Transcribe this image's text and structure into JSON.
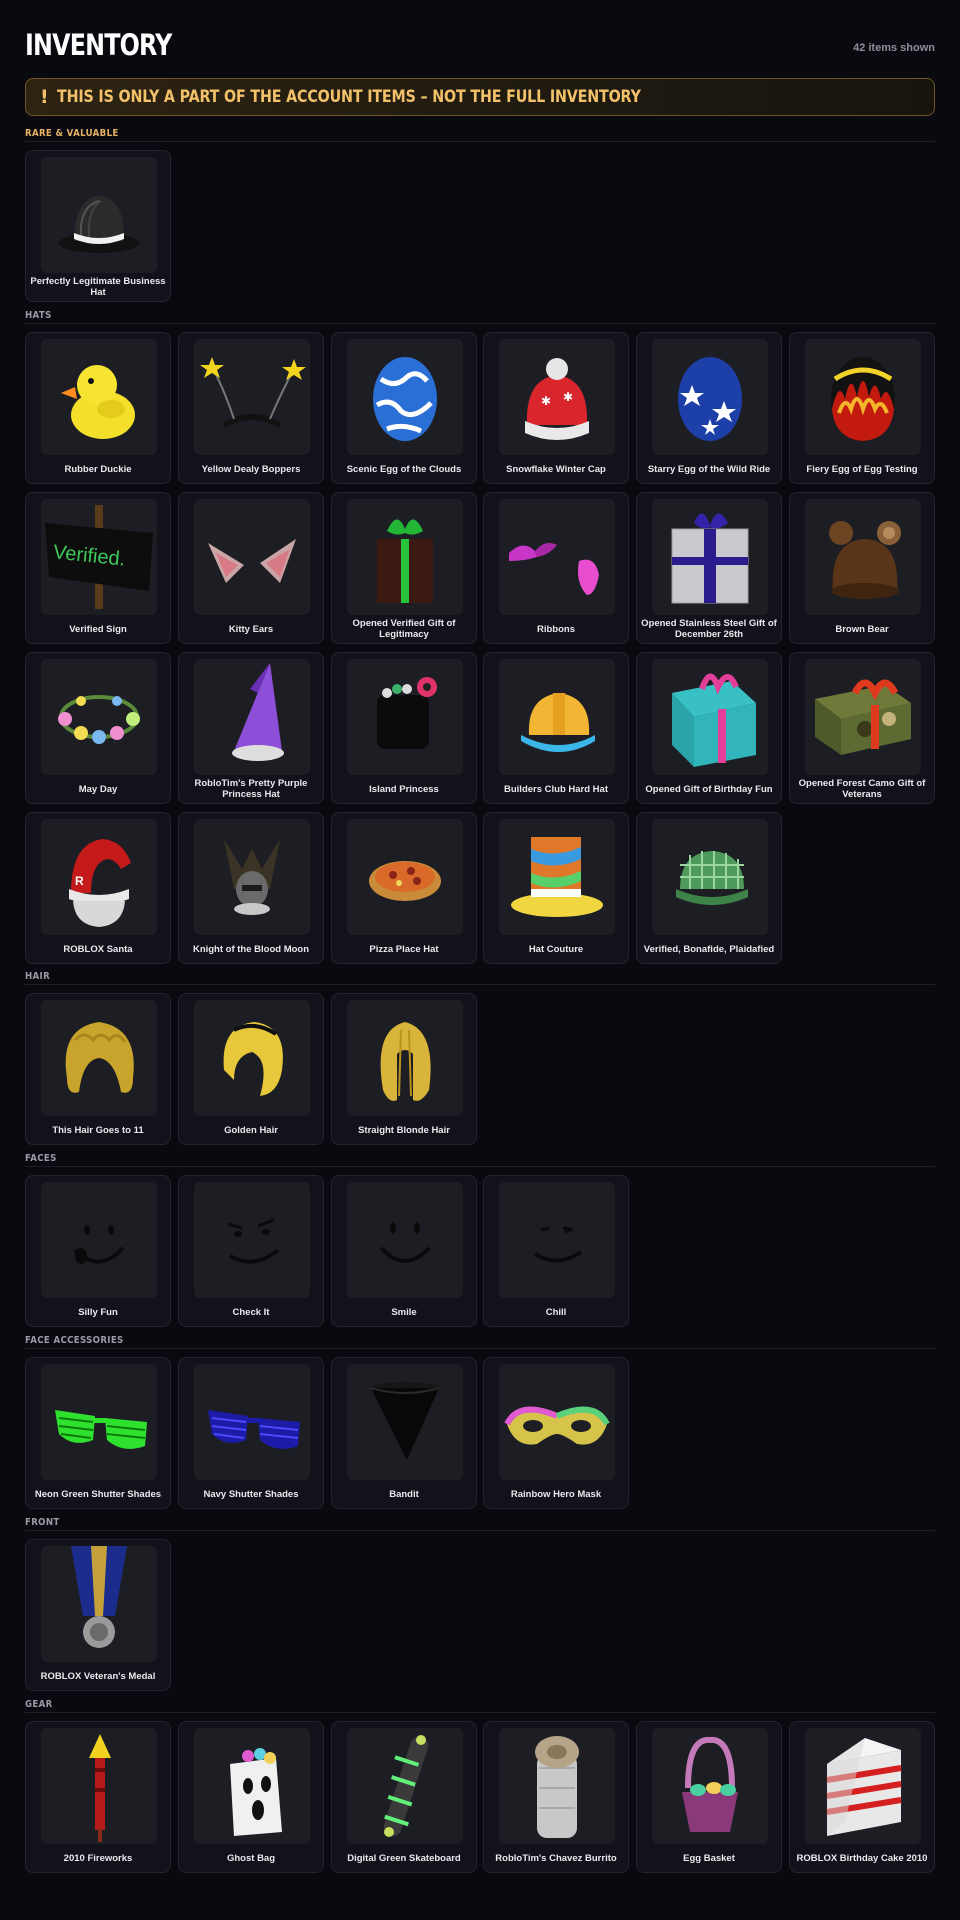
{
  "header": {
    "title": "INVENTORY",
    "count_label": "42 items shown"
  },
  "warning": {
    "text": "THIS IS ONLY A PART OF THE ACCOUNT ITEMS – NOT THE FULL INVENTORY",
    "icon": "exclamation-icon"
  },
  "colors": {
    "background": "#090a10",
    "card": "#12131a",
    "accent": "#e5b063"
  },
  "sections": [
    {
      "label": "RARE & VALUABLE",
      "items": [
        {
          "name": "Perfectly Legitimate Business Hat",
          "icon": "fedora"
        }
      ]
    },
    {
      "label": "HATS",
      "items": [
        {
          "name": "Rubber Duckie",
          "icon": "duck"
        },
        {
          "name": "Yellow Dealy Boppers",
          "icon": "boppers"
        },
        {
          "name": "Scenic Egg of the Clouds",
          "icon": "egg-clouds"
        },
        {
          "name": "Snowflake Winter Cap",
          "icon": "winter-cap"
        },
        {
          "name": "Starry Egg of the Wild Ride",
          "icon": "egg-stars"
        },
        {
          "name": "Fiery Egg of Egg Testing",
          "icon": "egg-fire"
        },
        {
          "name": "Verified Sign",
          "icon": "sign"
        },
        {
          "name": "Kitty Ears",
          "icon": "kitty-ears"
        },
        {
          "name": "Opened Verified Gift of Legitimacy",
          "icon": "gift-dark"
        },
        {
          "name": "Ribbons",
          "icon": "ribbons"
        },
        {
          "name": "Opened Stainless Steel Gift of December 26th",
          "icon": "gift-steel"
        },
        {
          "name": "Brown Bear",
          "icon": "bear-hat"
        },
        {
          "name": "May Day",
          "icon": "flower-crown"
        },
        {
          "name": "RobloTim's Pretty Purple Princess Hat",
          "icon": "princess-hat"
        },
        {
          "name": "Island Princess",
          "icon": "island-princess"
        },
        {
          "name": "Builders Club Hard Hat",
          "icon": "hard-hat"
        },
        {
          "name": "Opened Gift of Birthday Fun",
          "icon": "gift-teal"
        },
        {
          "name": "Opened Forest Camo Gift of Veterans",
          "icon": "gift-camo"
        },
        {
          "name": "ROBLOX Santa",
          "icon": "santa"
        },
        {
          "name": "Knight of the Blood Moon",
          "icon": "knight"
        },
        {
          "name": "Pizza Place Hat",
          "icon": "pizza"
        },
        {
          "name": "Hat Couture",
          "icon": "couture"
        },
        {
          "name": "Verified, Bonafide, Plaidafied",
          "icon": "plaid-cap"
        }
      ]
    },
    {
      "label": "HAIR",
      "items": [
        {
          "name": "This Hair Goes to 11",
          "icon": "hair-curly"
        },
        {
          "name": "Golden Hair",
          "icon": "hair-golden"
        },
        {
          "name": "Straight Blonde Hair",
          "icon": "hair-straight"
        }
      ]
    },
    {
      "label": "FACES",
      "items": [
        {
          "name": "Silly Fun",
          "icon": "face-silly"
        },
        {
          "name": "Check It",
          "icon": "face-check"
        },
        {
          "name": "Smile",
          "icon": "face-smile"
        },
        {
          "name": "Chill",
          "icon": "face-chill"
        }
      ]
    },
    {
      "label": "FACE ACCESSORIES",
      "items": [
        {
          "name": "Neon Green Shutter Shades",
          "icon": "shades-green"
        },
        {
          "name": "Navy Shutter Shades",
          "icon": "shades-navy"
        },
        {
          "name": "Bandit",
          "icon": "bandit"
        },
        {
          "name": "Rainbow Hero Mask",
          "icon": "hero-mask"
        }
      ]
    },
    {
      "label": "FRONT",
      "items": [
        {
          "name": "ROBLOX Veteran's Medal",
          "icon": "medal"
        }
      ]
    },
    {
      "label": "GEAR",
      "items": [
        {
          "name": "2010 Fireworks",
          "icon": "firework"
        },
        {
          "name": "Ghost Bag",
          "icon": "ghost-bag"
        },
        {
          "name": "Digital Green Skateboard",
          "icon": "skateboard"
        },
        {
          "name": "RobloTim's Chavez Burrito",
          "icon": "burrito"
        },
        {
          "name": "Egg Basket",
          "icon": "egg-basket"
        },
        {
          "name": "ROBLOX Birthday Cake 2010",
          "icon": "cake"
        }
      ]
    }
  ]
}
